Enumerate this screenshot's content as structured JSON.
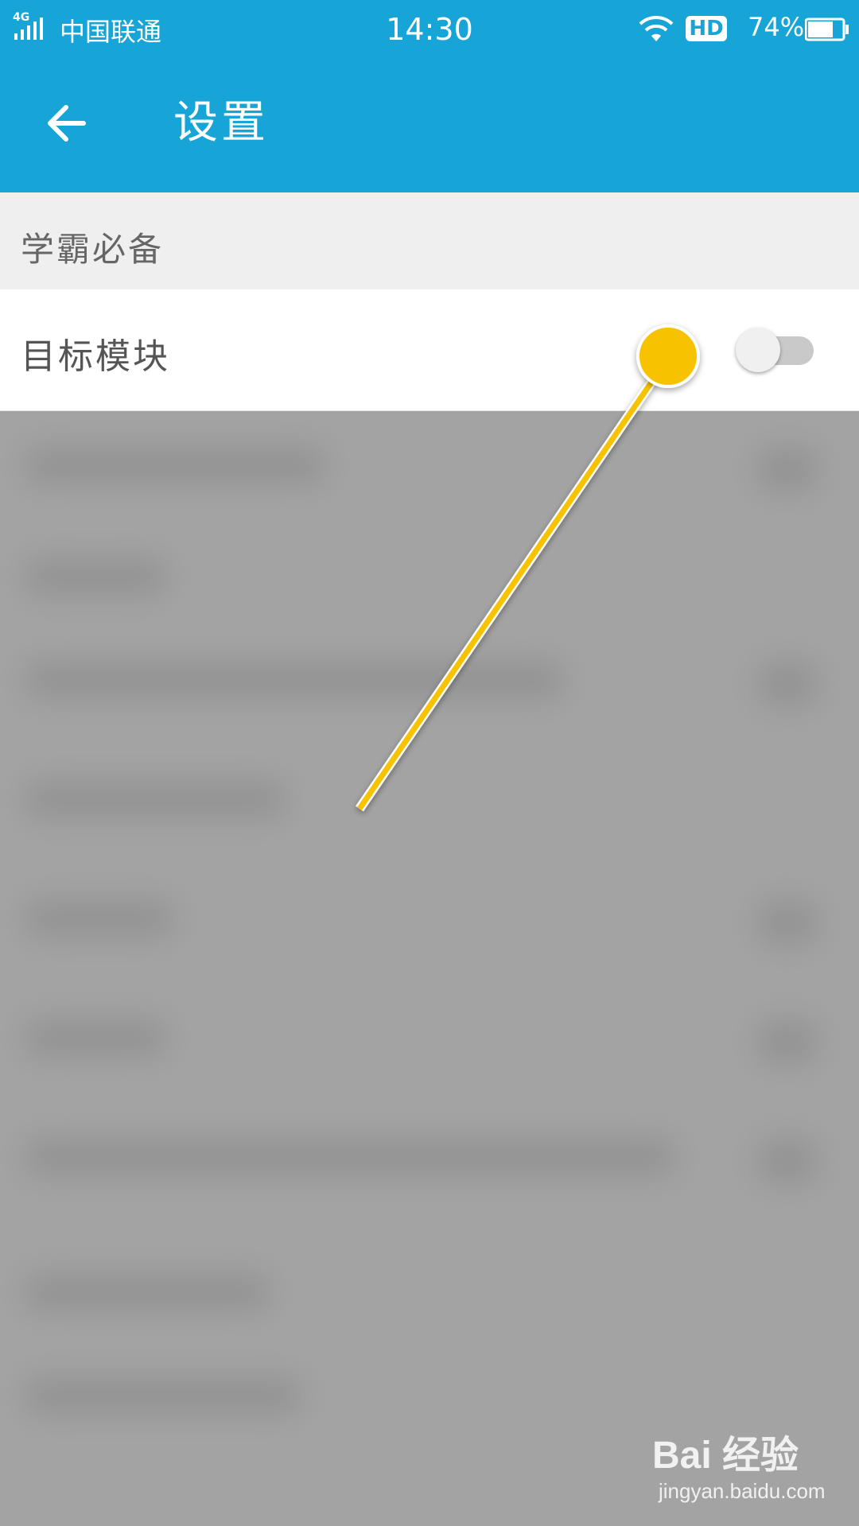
{
  "status_bar": {
    "network": "4G",
    "carrier": "中国联通",
    "time": "14:30",
    "hd_badge": "HD",
    "battery_percent": "74%",
    "battery_level": 0.74
  },
  "app_bar": {
    "back_icon": "arrow-left-icon",
    "title": "设置"
  },
  "section": {
    "header": "学霸必备"
  },
  "settings": [
    {
      "label": "目标模块",
      "toggle_on": false
    }
  ],
  "colors": {
    "primary": "#17a5d8",
    "annotation": "#f7c200",
    "blur_overlay": "#a3a3a3"
  },
  "watermark": {
    "brand": "Bai 经验",
    "url": "jingyan.baidu.com"
  }
}
